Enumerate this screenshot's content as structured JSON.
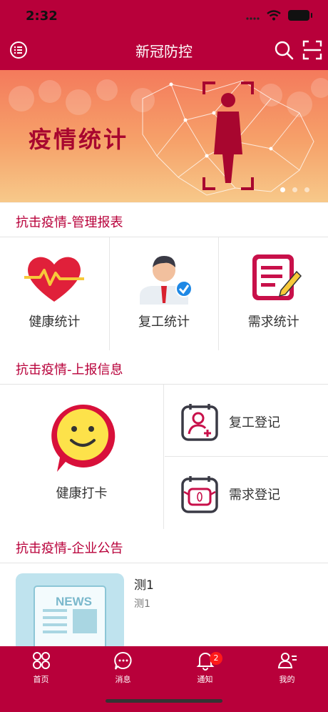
{
  "status": {
    "time": "2:32"
  },
  "nav": {
    "title": "新冠防控"
  },
  "banner": {
    "text": "疫情统计"
  },
  "section1": {
    "title": "抗击疫情-管理报表"
  },
  "stats": [
    {
      "label": "健康统计",
      "icon": "heart-pulse-icon"
    },
    {
      "label": "复工统计",
      "icon": "worker-check-icon"
    },
    {
      "label": "需求统计",
      "icon": "notepad-pencil-icon"
    }
  ],
  "section2": {
    "title": "抗击疫情-上报信息"
  },
  "report": {
    "left": {
      "label": "健康打卡",
      "icon": "smiley-bubble-icon"
    },
    "right": [
      {
        "label": "复工登记",
        "icon": "user-add-calendar-icon"
      },
      {
        "label": "需求登记",
        "icon": "mask-calendar-icon"
      }
    ]
  },
  "section3": {
    "title": "抗击疫情-企业公告"
  },
  "news": {
    "title": "测1",
    "subtitle": "测1",
    "thumb_text": "NEWS"
  },
  "tabs": [
    {
      "label": "首页",
      "icon": "home-grid-icon"
    },
    {
      "label": "消息",
      "icon": "message-icon"
    },
    {
      "label": "通知",
      "icon": "bell-icon",
      "badge": "2"
    },
    {
      "label": "我的",
      "icon": "profile-icon"
    }
  ],
  "colors": {
    "brand": "#b8003a",
    "badge": "#ff1a1a"
  }
}
